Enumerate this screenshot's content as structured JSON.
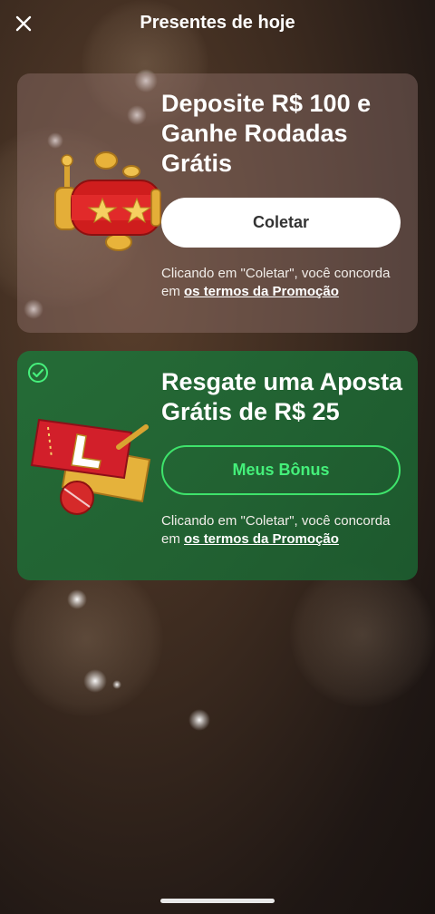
{
  "header": {
    "title": "Presentes de hoje",
    "close_icon": "close-icon"
  },
  "cards": [
    {
      "title_line1": "Deposite R$ 100 e",
      "title_line2": "Ganhe Rodadas",
      "title_line3": "Grátis",
      "button_label": "Coletar",
      "terms_prefix": "Clicando em \"Coletar\", você concorda em ",
      "terms_link": "os termos da Promoção",
      "illustration_icon": "slot-machine-icon"
    },
    {
      "title_line1": "Resgate uma Aposta",
      "title_line2": "Grátis de R$ 25",
      "button_label": "Meus Bônus",
      "terms_prefix": "Clicando em \"Coletar\", você concorda em ",
      "terms_link": "os termos da Promoção",
      "illustration_icon": "ticket-ball-icon",
      "status_icon": "check-circle-icon"
    }
  ],
  "colors": {
    "accent_green": "#3ee36b",
    "card_green": "#217038",
    "slot_red": "#d11f1f",
    "gold": "#e8b33a"
  }
}
